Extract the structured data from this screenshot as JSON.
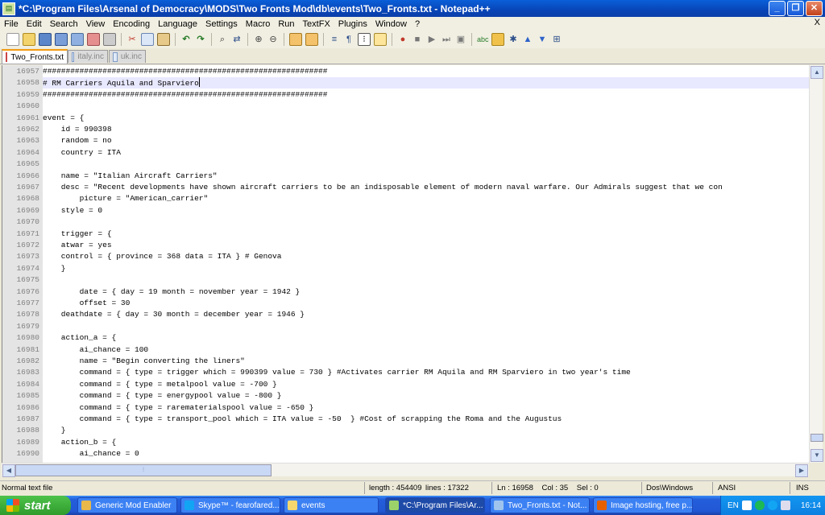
{
  "window": {
    "title": "*C:\\Program Files\\Arsenal of Democracy\\MODS\\Two Fronts Mod\\db\\events\\Two_Fronts.txt - Notepad++",
    "minimize": "_",
    "maximize": "❐",
    "close": "✕"
  },
  "menu": {
    "items": [
      "File",
      "Edit",
      "Search",
      "View",
      "Encoding",
      "Language",
      "Settings",
      "Macro",
      "Run",
      "TextFX",
      "Plugins",
      "Window",
      "?"
    ],
    "doc_close": "X"
  },
  "toolbar": {
    "icons": [
      "new-file-icon",
      "open-file-icon",
      "save-icon",
      "save-all-icon",
      "close-icon",
      "close-all-icon",
      "print-icon",
      "cut-icon",
      "copy-icon",
      "paste-icon",
      "undo-icon",
      "redo-icon",
      "find-icon",
      "replace-icon",
      "zoom-in-icon",
      "zoom-out-icon",
      "sync-v-icon",
      "sync-h-icon",
      "wrap-icon",
      "show-all-chars-icon",
      "indent-guide-icon",
      "doc-map-icon",
      "record-macro-icon",
      "stop-macro-icon",
      "play-macro-icon",
      "play-multiple-icon",
      "save-macro-icon",
      "spell-check-icon",
      "spell-settings-icon",
      "up-icon",
      "down-icon",
      "tidy-icon"
    ],
    "accent": "#c0392b"
  },
  "tabs": [
    {
      "label": "Two_Fronts.txt",
      "active": true
    },
    {
      "label": "italy.inc",
      "active": false
    },
    {
      "label": "uk.inc",
      "active": false
    }
  ],
  "editor": {
    "current_line_index": 1,
    "lines": [
      {
        "n": "16957",
        "t": "##############################################################"
      },
      {
        "n": "16958",
        "t": "# RM Carriers Aquila and Sparviero"
      },
      {
        "n": "16959",
        "t": "##############################################################"
      },
      {
        "n": "16960",
        "t": ""
      },
      {
        "n": "16961",
        "t": "event = {"
      },
      {
        "n": "16962",
        "t": "    id = 990398"
      },
      {
        "n": "16963",
        "t": "    random = no"
      },
      {
        "n": "16964",
        "t": "    country = ITA"
      },
      {
        "n": "16965",
        "t": ""
      },
      {
        "n": "16966",
        "t": "    name = \"Italian Aircraft Carriers\""
      },
      {
        "n": "16967",
        "t": "    desc = \"Recent developments have shown aircraft carriers to be an indisposable element of modern naval warfare. Our Admirals suggest that we con"
      },
      {
        "n": "16968",
        "t": "        picture = \"American_carrier\""
      },
      {
        "n": "16969",
        "t": "    style = 0"
      },
      {
        "n": "16970",
        "t": ""
      },
      {
        "n": "16971",
        "t": "    trigger = {"
      },
      {
        "n": "16972",
        "t": "    atwar = yes"
      },
      {
        "n": "16973",
        "t": "    control = { province = 368 data = ITA } # Genova"
      },
      {
        "n": "16974",
        "t": "    }"
      },
      {
        "n": "16975",
        "t": ""
      },
      {
        "n": "16976",
        "t": "        date = { day = 19 month = november year = 1942 }"
      },
      {
        "n": "16977",
        "t": "        offset = 30"
      },
      {
        "n": "16978",
        "t": "    deathdate = { day = 30 month = december year = 1946 }"
      },
      {
        "n": "16979",
        "t": ""
      },
      {
        "n": "16980",
        "t": "    action_a = {"
      },
      {
        "n": "16981",
        "t": "        ai_chance = 100"
      },
      {
        "n": "16982",
        "t": "        name = \"Begin converting the liners\""
      },
      {
        "n": "16983",
        "t": "        command = { type = trigger which = 990399 value = 730 } #Activates carrier RM Aquila and RM Sparviero in two year's time"
      },
      {
        "n": "16984",
        "t": "        command = { type = metalpool value = -700 }"
      },
      {
        "n": "16985",
        "t": "        command = { type = energypool value = -800 }"
      },
      {
        "n": "16986",
        "t": "        command = { type = rarematerialspool value = -650 }"
      },
      {
        "n": "16987",
        "t": "        command = { type = transport_pool which = ITA value = -50  } #Cost of scrapping the Roma and the Augustus"
      },
      {
        "n": "16988",
        "t": "    }"
      },
      {
        "n": "16989",
        "t": "    action_b = {"
      },
      {
        "n": "16990",
        "t": "        ai_chance = 0"
      }
    ]
  },
  "status": {
    "type": "Normal text file",
    "length": "length : 454409",
    "lines": "lines : 17322",
    "position": "Ln : 16958    Col : 35    Sel : 0",
    "eol": "Dos\\Windows",
    "encoding": "ANSI",
    "mode": "INS"
  },
  "taskbar": {
    "start": "start",
    "tasks": [
      {
        "label": "Generic Mod Enabler",
        "icon": "gme-icon",
        "color": "#e8b84a"
      },
      {
        "label": "Skype™ - fearofared...",
        "icon": "skype-icon",
        "color": "#12a5f4"
      },
      {
        "label": "events",
        "icon": "folder-icon",
        "color": "#f5d76e"
      },
      {
        "label": "*C:\\Program Files\\Ar...",
        "icon": "notepadpp-icon",
        "color": "#9bd36a",
        "active": true
      },
      {
        "label": "Two_Fronts.txt - Not...",
        "icon": "notepad-icon",
        "color": "#9ec4ee"
      },
      {
        "label": "Image hosting, free p...",
        "icon": "firefox-icon",
        "color": "#e66000"
      }
    ],
    "tray": {
      "lang": "EN",
      "clock": "16:14"
    }
  },
  "scroll": {
    "vertical_fraction": 0.978,
    "horizontal_fraction": 0.0
  }
}
